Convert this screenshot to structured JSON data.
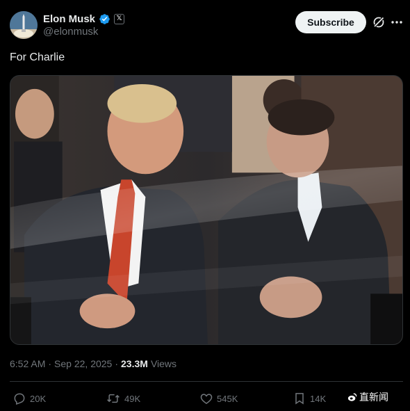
{
  "author": {
    "display_name": "Elon Musk",
    "handle": "@elonmusk",
    "verified": true,
    "badge_glyph": "𝕏",
    "avatar_icon": "rocket-launch-avatar"
  },
  "header": {
    "subscribe_label": "Subscribe",
    "grok_icon": "grok-icon",
    "more_icon": "more-icon"
  },
  "post": {
    "text": "For Charlie"
  },
  "meta": {
    "time": "6:52 AM",
    "separator": "·",
    "date": "Sep 22, 2025",
    "separator2": "·",
    "views_count": "23.3M",
    "views_label": "Views"
  },
  "actions": {
    "replies": "20K",
    "reposts": "49K",
    "likes": "545K",
    "bookmarks": "14K"
  },
  "watermark": {
    "text": "直新闻"
  },
  "colors": {
    "background": "#000000",
    "text_primary": "#e7e9ea",
    "text_secondary": "#71767b",
    "verified_blue": "#1d9bf0",
    "divider": "#2f3336"
  }
}
